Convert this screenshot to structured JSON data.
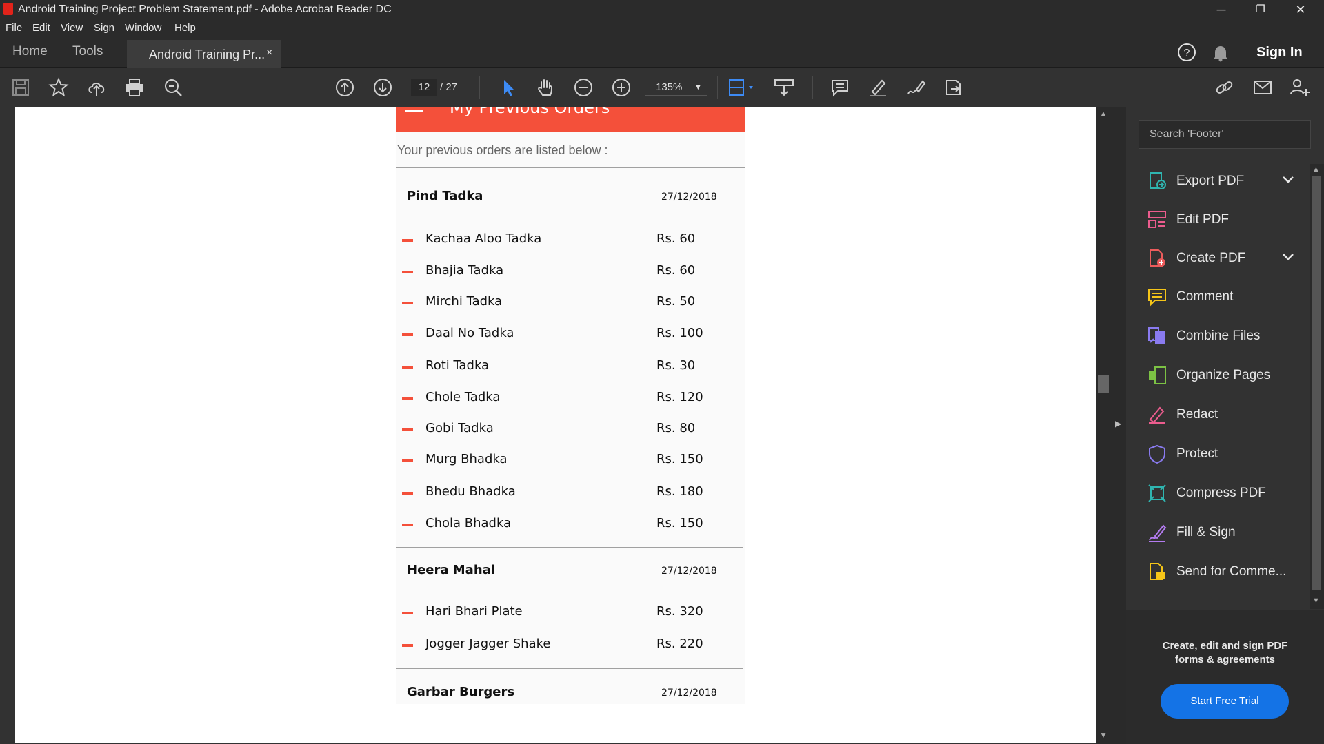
{
  "window": {
    "title": "Android Training Project Problem Statement.pdf - Adobe Acrobat Reader DC",
    "controls": [
      "─",
      "❐",
      "✕"
    ]
  },
  "menu": [
    "File",
    "Edit",
    "View",
    "Sign",
    "Window",
    "Help"
  ],
  "tabs": {
    "home": "Home",
    "tools": "Tools",
    "document": "Android Training Pr...",
    "close": "×",
    "sign_in": "Sign In"
  },
  "toolbar": {
    "page_current": "12",
    "page_total": "/ 27",
    "zoom": "135%"
  },
  "document": {
    "header_title": "My Previous Orders",
    "intro": "Your previous orders are listed below :",
    "orders": [
      {
        "restaurant": "Pind Tadka",
        "date": "27/12/2018",
        "items": [
          {
            "name": "Kachaa Aloo Tadka",
            "price": "Rs. 60"
          },
          {
            "name": "Bhajia Tadka",
            "price": "Rs. 60"
          },
          {
            "name": "Mirchi Tadka",
            "price": "Rs. 50"
          },
          {
            "name": "Daal No Tadka",
            "price": "Rs. 100"
          },
          {
            "name": "Roti Tadka",
            "price": "Rs. 30"
          },
          {
            "name": "Chole Tadka",
            "price": "Rs. 120"
          },
          {
            "name": "Gobi Tadka",
            "price": "Rs. 80"
          },
          {
            "name": "Murg Bhadka",
            "price": "Rs. 150"
          },
          {
            "name": "Bhedu Bhadka",
            "price": "Rs. 180"
          },
          {
            "name": "Chola Bhadka",
            "price": "Rs. 150"
          }
        ]
      },
      {
        "restaurant": "Heera Mahal",
        "date": "27/12/2018",
        "items": [
          {
            "name": "Hari Bhari Plate",
            "price": "Rs. 320"
          },
          {
            "name": "Jogger Jagger Shake",
            "price": "Rs. 220"
          }
        ]
      },
      {
        "restaurant": "Garbar Burgers",
        "date": "27/12/2018",
        "items": []
      }
    ]
  },
  "right_pane": {
    "search_placeholder": "Search 'Footer'",
    "tools": [
      {
        "label": "Export PDF",
        "icon": "export-pdf-icon",
        "color": "#2fb5b0",
        "expandable": true
      },
      {
        "label": "Edit PDF",
        "icon": "edit-pdf-icon",
        "color": "#ec5c8e",
        "expandable": false
      },
      {
        "label": "Create PDF",
        "icon": "create-pdf-icon",
        "color": "#ec5c5c",
        "expandable": true
      },
      {
        "label": "Comment",
        "icon": "comment-icon",
        "color": "#f5c518",
        "expandable": false
      },
      {
        "label": "Combine Files",
        "icon": "combine-files-icon",
        "color": "#8a7bf0",
        "expandable": false
      },
      {
        "label": "Organize Pages",
        "icon": "organize-pages-icon",
        "color": "#7cc244",
        "expandable": false
      },
      {
        "label": "Redact",
        "icon": "redact-icon",
        "color": "#ec5c8e",
        "expandable": false
      },
      {
        "label": "Protect",
        "icon": "protect-icon",
        "color": "#8a7bf0",
        "expandable": false
      },
      {
        "label": "Compress PDF",
        "icon": "compress-pdf-icon",
        "color": "#2fb5b0",
        "expandable": false
      },
      {
        "label": "Fill & Sign",
        "icon": "fill-sign-icon",
        "color": "#b37bf0",
        "expandable": false
      },
      {
        "label": "Send for Comme...",
        "icon": "send-comments-icon",
        "color": "#f5c518",
        "expandable": false
      }
    ],
    "promo_text_1": "Create, edit and sign PDF",
    "promo_text_2": "forms & agreements",
    "promo_button": "Start Free Trial"
  }
}
